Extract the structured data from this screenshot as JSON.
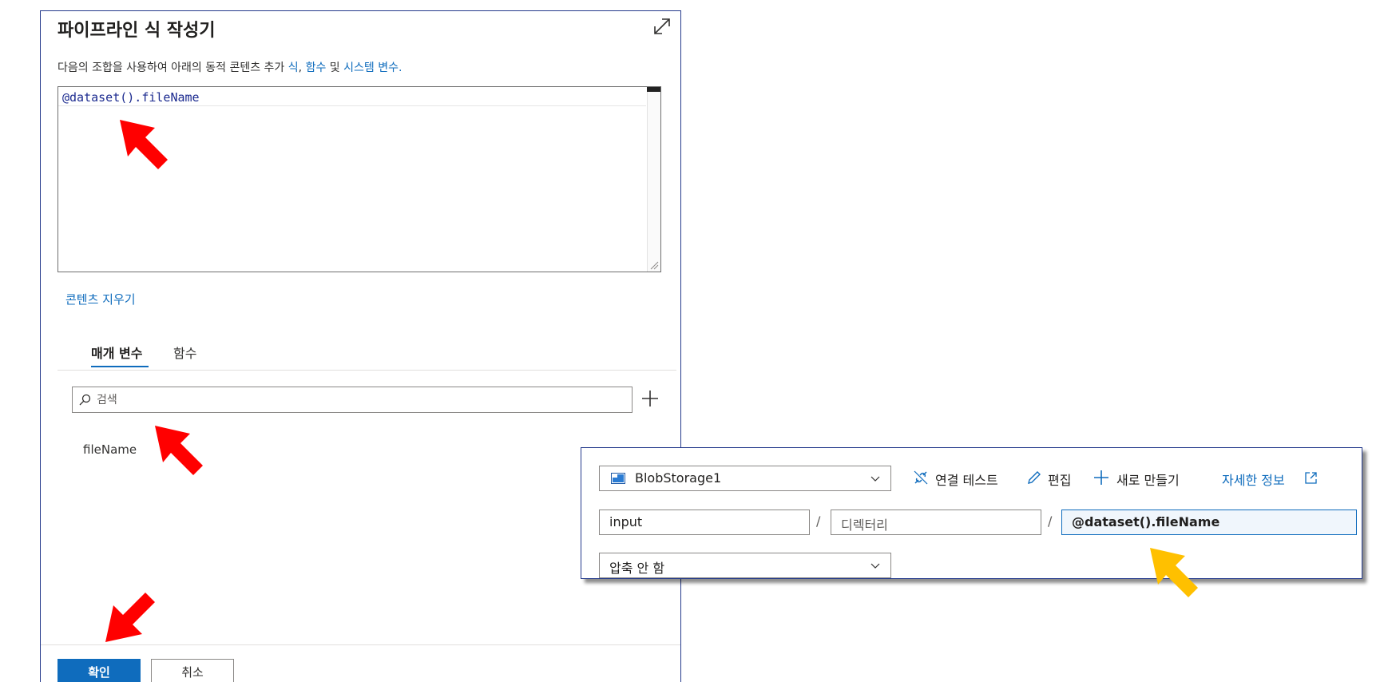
{
  "builder": {
    "title": "파이프라인 식 작성기",
    "description_prefix": "다음의 조합을 사용하여 아래의 동적 콘텐츠 추가 ",
    "link_expression": "식",
    "separator": ", ",
    "link_functions": "함수",
    "conjunction": " 및 ",
    "link_system_vars": "시스템 변수",
    "period": ".",
    "editor_value": "@dataset().fileName",
    "clear_label": "콘텐츠 지우기",
    "tabs": [
      {
        "label": "매개 변수",
        "active": true
      },
      {
        "label": "함수",
        "active": false
      }
    ],
    "search_placeholder": "검색",
    "parameters": [
      "fileName"
    ],
    "ok_label": "확인",
    "cancel_label": "취소"
  },
  "dataset": {
    "linked_service": "BlobStorage1",
    "toolbar": {
      "test_connection": "연결 테스트",
      "edit": "편집",
      "new": "새로 만들기",
      "more_info": "자세한 정보"
    },
    "container": "input",
    "directory_placeholder": "디렉터리",
    "file_name": "@dataset().fileName",
    "path_separator": "/",
    "compression": "압축 안 함"
  },
  "colors": {
    "accent": "#0f6cbd",
    "border_dark": "#243a8c",
    "annotation_red": "#ff0000",
    "annotation_yellow": "#ffc000"
  },
  "icons": [
    "expand-icon",
    "search-icon",
    "add-icon",
    "storage-icon",
    "chevron-down-icon",
    "link-test-icon",
    "edit-icon",
    "plus-icon",
    "external-link-icon",
    "arrow-annotation"
  ]
}
